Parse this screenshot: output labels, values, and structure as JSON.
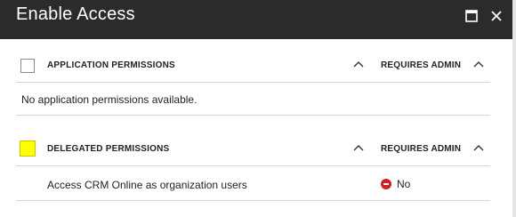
{
  "window": {
    "title": "Enable Access",
    "controls": {
      "maximize_icon": "maximize-icon",
      "close_icon": "close-icon"
    }
  },
  "application_section": {
    "header_label": "APPLICATION PERMISSIONS",
    "requires_admin_label": "REQUIRES ADMIN",
    "empty_message": "No application permissions available."
  },
  "delegated_section": {
    "header_label": "DELEGATED PERMISSIONS",
    "requires_admin_label": "REQUIRES ADMIN",
    "checkbox_highlight_color": "#ffff00",
    "permissions": [
      {
        "name": "Access CRM Online as organization users",
        "requires_admin": "No",
        "status_icon": "no-entry-icon",
        "status_color": "#d11f27"
      }
    ]
  },
  "colors": {
    "titlebar_bg": "#2b2b2b",
    "divider": "#d6d6d6"
  }
}
